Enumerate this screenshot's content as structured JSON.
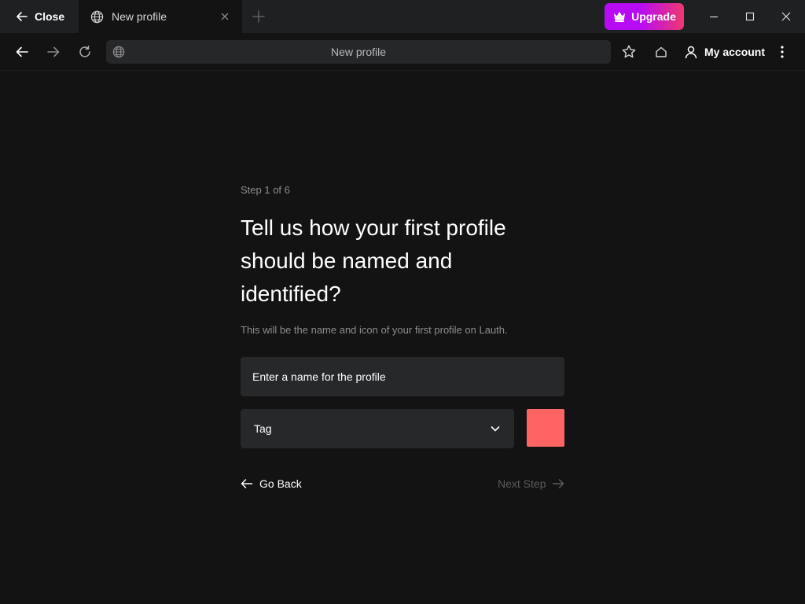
{
  "titlebar": {
    "close_label": "Close",
    "tab_title": "New profile",
    "upgrade_label": "Upgrade",
    "upgrade_gradient": [
      "#b70bf4",
      "#f0386f"
    ]
  },
  "toolbar": {
    "url_text": "New profile",
    "account_label": "My account"
  },
  "wizard": {
    "step_label": "Step 1 of 6",
    "heading_line1": "Tell us how your first profile",
    "heading_line2": "should be named and",
    "heading_line3": "identified?",
    "subtext": "This will be the name and icon of your first profile on Lauth.",
    "name_placeholder": "Enter a name for the profile",
    "name_value": "",
    "tag_label": "Tag",
    "swatch_color": "#ff6464",
    "back_label": "Go Back",
    "next_label": "Next Step"
  },
  "icons": {
    "close": "arrow-left-icon",
    "tab": "globe-icon",
    "tab_close": "x-icon",
    "new_tab": "plus-icon",
    "upgrade": "crown-icon",
    "back": "arrow-left-icon",
    "forward": "arrow-right-icon",
    "reload": "reload-icon",
    "bookmark": "star-icon",
    "home": "home-icon",
    "account": "user-icon",
    "menu": "kebab-menu-icon",
    "select": "chevron-down-icon"
  },
  "colors": {
    "background": "#131314",
    "titlebar": "#1f2022",
    "input": "#27282a",
    "muted_text": "#8d8d8d",
    "disabled_text": "#5c5c5e"
  }
}
